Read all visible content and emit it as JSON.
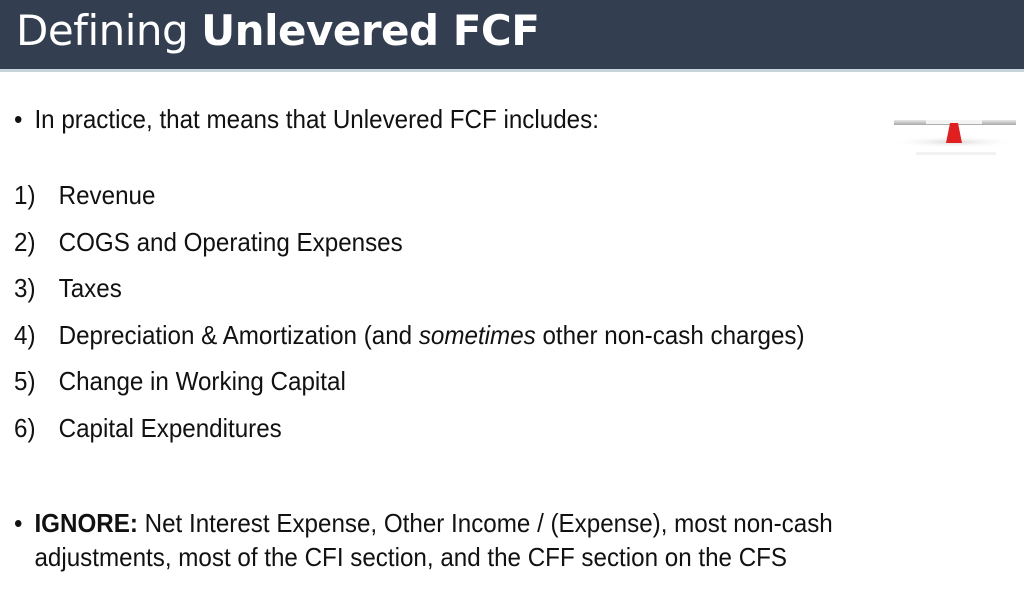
{
  "title": {
    "regular": "Defining",
    "bold": "Unlevered FCF"
  },
  "intro": {
    "bullet": "•",
    "text": "In practice, that means that Unlevered FCF includes:"
  },
  "items": [
    {
      "num": "1)",
      "text": "Revenue"
    },
    {
      "num": "2)",
      "text": "COGS and Operating Expenses"
    },
    {
      "num": "3)",
      "text": "Taxes"
    },
    {
      "num": "4)",
      "text_before": "Depreciation & Amortization (and ",
      "emphasis": "sometimes",
      "text_after": " other non-cash charges)"
    },
    {
      "num": "5)",
      "text": "Change in Working Capital"
    },
    {
      "num": "6)",
      "text": "Capital Expenditures"
    }
  ],
  "ignore": {
    "bullet": "•",
    "label": "IGNORE:",
    "line1": " Net Interest Expense, Other Income / (Expense), most non-cash",
    "line2": "adjustments, most of the CFI section, and the CFF section on the CFS"
  },
  "graphic": {
    "icon": "seesaw-balance-icon",
    "accent_color": "#e02020"
  },
  "colors": {
    "title_bar": "#333f50",
    "title_text": "#ffffff",
    "body_text": "#111111"
  }
}
